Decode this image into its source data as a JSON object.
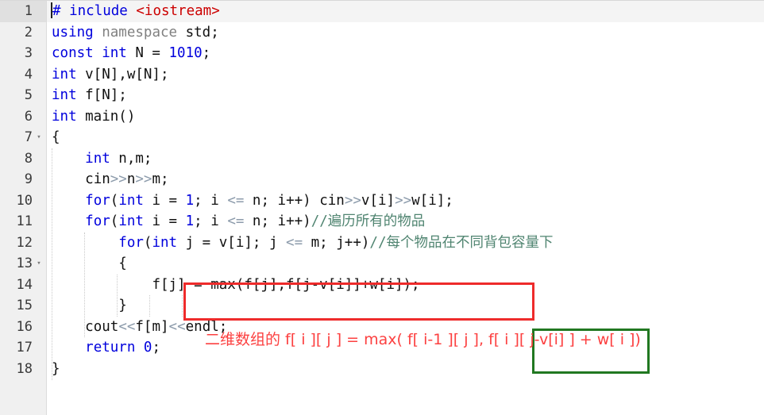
{
  "editor": {
    "language": "C++",
    "active_line": 1,
    "total_lines": 18,
    "colors": {
      "keyword": "#0000dd",
      "string": "#cc0000",
      "comment": "#4f8470",
      "operator": "#8c9bab",
      "gutter_bg": "#f0f0f0",
      "annotation_red": "#ee2b2b",
      "annotation_red_text": "#fc4040",
      "annotation_green": "#217821",
      "background": "#ffffff"
    }
  },
  "gutter": {
    "numbers": [
      "1",
      "2",
      "3",
      "4",
      "5",
      "6",
      "7",
      "8",
      "9",
      "10",
      "11",
      "12",
      "13",
      "14",
      "15",
      "16",
      "17",
      "18"
    ],
    "fold_lines": [
      7,
      13
    ],
    "fold_glyph": "▾"
  },
  "lines": [
    {
      "n": "1",
      "text": "# include <iostream>"
    },
    {
      "n": "2",
      "text": "using namespace std;"
    },
    {
      "n": "3",
      "text": "const int N = 1010;"
    },
    {
      "n": "4",
      "text": "int v[N],w[N];"
    },
    {
      "n": "5",
      "text": "int f[N];"
    },
    {
      "n": "6",
      "text": "int main()"
    },
    {
      "n": "7",
      "text": "{"
    },
    {
      "n": "8",
      "text": "    int n,m;"
    },
    {
      "n": "9",
      "text": "    cin>>n>>m;"
    },
    {
      "n": "10",
      "text": "    for(int i = 1; i <= n; i++) cin>>v[i]>>w[i];"
    },
    {
      "n": "11",
      "text": "    for(int i = 1; i <= n; i++)//遍历所有的物品"
    },
    {
      "n": "12",
      "text": "        for(int j = v[i]; j <= m; j++)//每个物品在不同背包容量下"
    },
    {
      "n": "13",
      "text": "        {"
    },
    {
      "n": "14",
      "text": "            f[j] = max(f[j],f[j-v[i]]+w[i]);"
    },
    {
      "n": "15",
      "text": "        }"
    },
    {
      "n": "16",
      "text": "    cout<<f[m]<<endl;"
    },
    {
      "n": "17",
      "text": "    return 0;"
    },
    {
      "n": "18",
      "text": "}"
    }
  ],
  "tokens": {
    "l1_hash": "#",
    "l1_include": " include ",
    "l1_header": "<iostream>",
    "l2_using": "using",
    "l2_namespace": " namespace ",
    "l2_std": "std;",
    "l3_const": "const int",
    "l3_rest": " N = ",
    "l3_num": "1010",
    "l3_semi": ";",
    "l4_int": "int",
    "l4_rest": " v[N],w[N];",
    "l5_int": "int",
    "l5_rest": " f[N];",
    "l6_int": "int",
    "l6_rest": " main()",
    "l7": "{",
    "l8_indent": "    ",
    "l8_int": "int",
    "l8_rest": " n,m;",
    "l9_indent": "    ",
    "l9_cin": "cin",
    "l9_op1": ">>",
    "l9_n": "n",
    "l9_op2": ">>",
    "l9_m": "m;",
    "l10_indent": "    ",
    "l10_for": "for",
    "l10_p1": "(",
    "l10_int": "int",
    "l10_p2": " i = ",
    "l10_one": "1",
    "l10_p3": "; i ",
    "l10_le": "<=",
    "l10_p4": " n; i++) ",
    "l10_cin": "cin",
    "l10_op1": ">>",
    "l10_v": "v[i]",
    "l10_op2": ">>",
    "l10_w": "w[i];",
    "l11_indent": "    ",
    "l11_for": "for",
    "l11_p1": "(",
    "l11_int": "int",
    "l11_p2": " i = ",
    "l11_one": "1",
    "l11_p3": "; i ",
    "l11_le": "<=",
    "l11_p4": " n; i++)",
    "l11_comment": "//遍历所有的物品",
    "l12_indent": "        ",
    "l12_for": "for",
    "l12_p1": "(",
    "l12_int": "int",
    "l12_p2": " j = v[i]; j ",
    "l12_le": "<=",
    "l12_p3": " m; j++)",
    "l12_comment": "//每个物品在不同背包容量下",
    "l13": "        {",
    "l14_indent": "            ",
    "l14_code": "f[j] = max(f[j],f[j-v[i]]+w[i]);",
    "l15": "        }",
    "l16_indent": "    ",
    "l16_cout": "cout",
    "l16_op1": "<<",
    "l16_fm": "f[m]",
    "l16_op2": "<<",
    "l16_endl": "endl;",
    "l17_indent": "    ",
    "l17_return": "return",
    "l17_zero": " 0",
    "l17_semi": ";",
    "l18": "}"
  },
  "annotations": {
    "red_box": {
      "label": "one-dimensional-dp-highlight",
      "encloses": "f[j] = max(f[j],f[j-v[i]]+w[i]);"
    },
    "green_box": {
      "label": "current-item-term-highlight",
      "encloses": "f[ i ][ j-v[i] ]"
    },
    "red_note": {
      "prefix_cn": "二维数组的",
      "formula_part1": " f[ i ][ j ] = max( f[ i-1 ][ j ],",
      "formula_boxed": "f[ i ][ j-v[i] ]",
      "formula_part2": "+ w[ i ])",
      "full": "二维数组的 f[ i ][ j ] = max( f[ i-1 ][ j ], f[ i ][ j-v[i] ] + w[ i ])"
    }
  }
}
